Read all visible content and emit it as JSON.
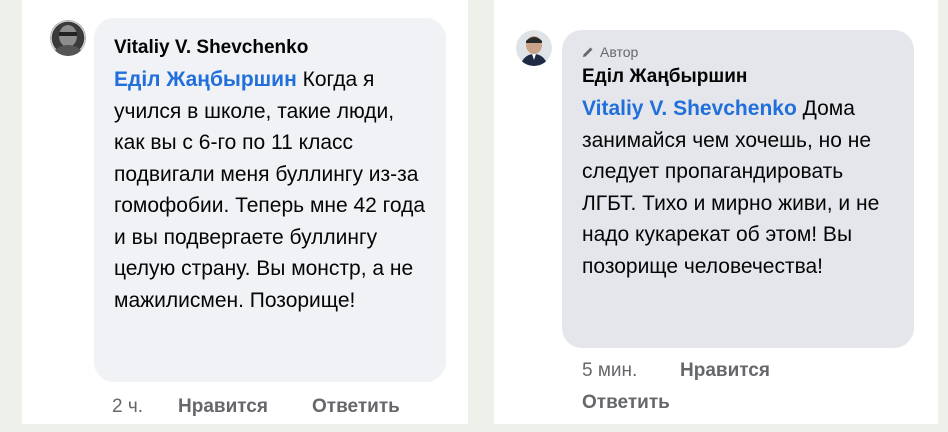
{
  "left_comment": {
    "author": "Vitaliy V. Shevchenko",
    "mention": "Еділ Жаңбыршин",
    "text": " Когда я учился в школе, такие люди, как вы с 6-го по 11 класс подвигали меня буллингу из-за гомофобии. Теперь мне 42 года и вы подвергаете буллингу целую страну. Вы монстр, а не мажилисмен. Позорище!",
    "time": "2 ч.",
    "like_label": "Нравится",
    "reply_label": "Ответить",
    "avatar_icon": "user-avatar-photo"
  },
  "right_comment": {
    "badge_icon": "pencil-icon",
    "badge_label": "Автор",
    "author": "Еділ Жаңбыршин",
    "mention": "Vitaliy V. Shevchenko",
    "text": " Дома занимайся чем хочешь, но не следует пропагандировать ЛГБТ. Тихо и мирно живи, и не надо кукарекат об этом! Вы позорище человечества!",
    "time": "5 мин.",
    "like_label": "Нравится",
    "reply_label": "Ответить",
    "avatar_icon": "user-avatar-photo"
  },
  "colors": {
    "mention": "#216fdb",
    "text": "#050505",
    "meta": "#65676b",
    "bubble_left": "#f0f2f5",
    "bubble_right": "#e4e6eb"
  }
}
